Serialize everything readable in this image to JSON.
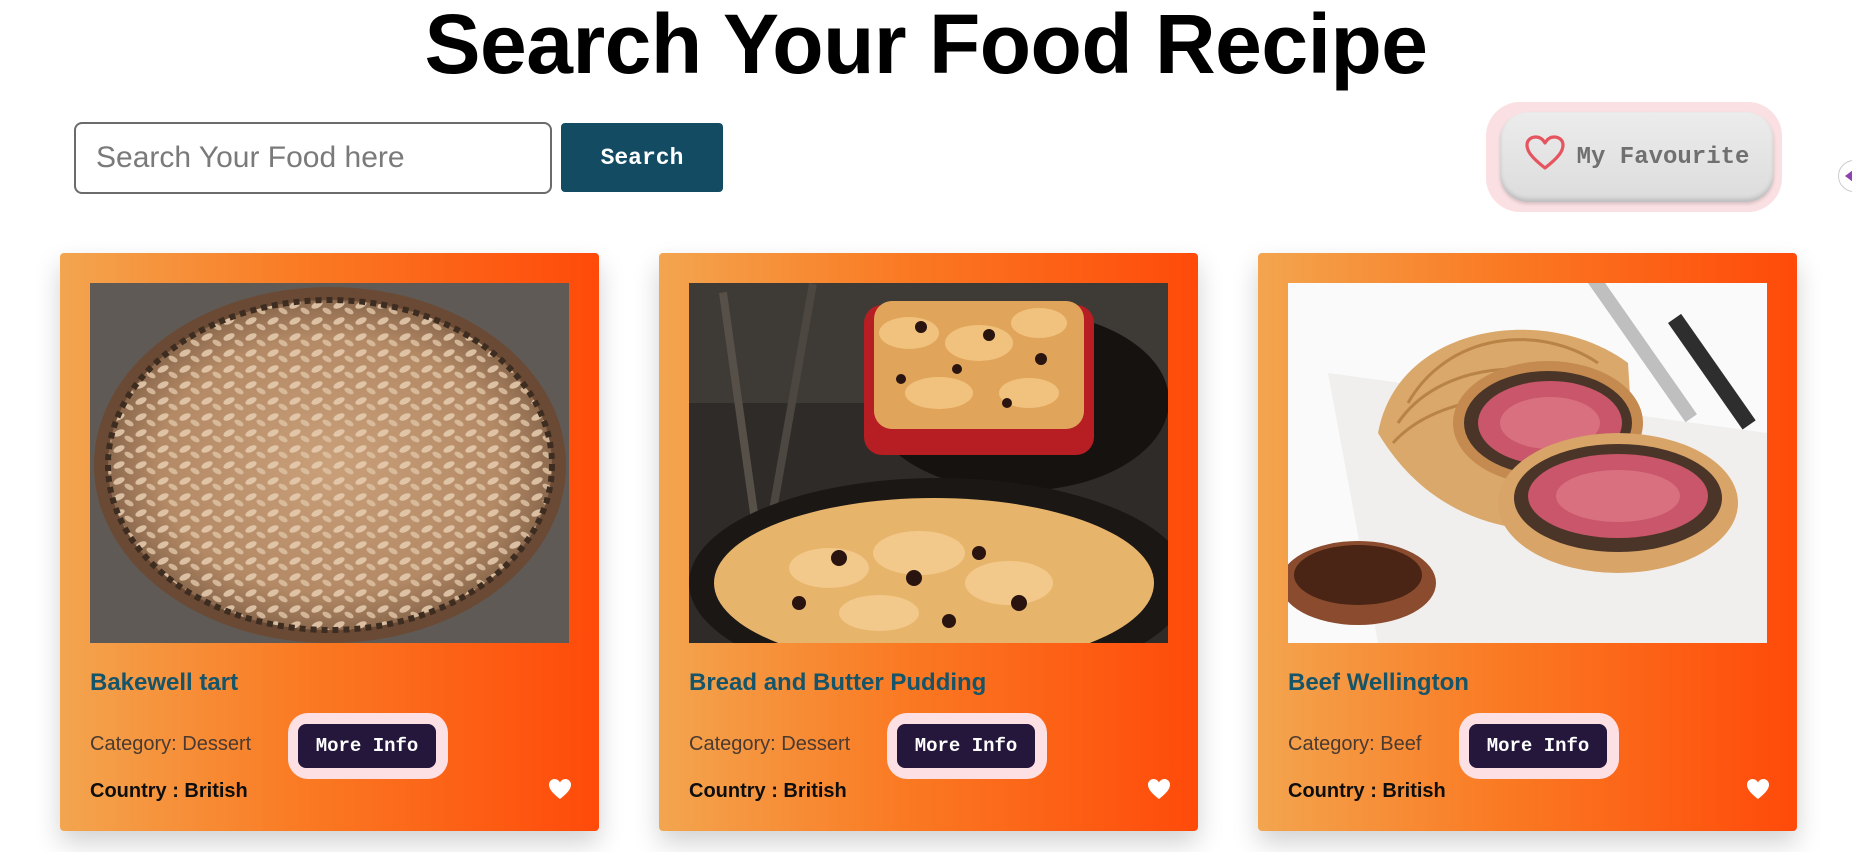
{
  "header": {
    "title": "Search Your Food Recipe"
  },
  "search": {
    "placeholder": "Search Your Food here",
    "value": "",
    "button_label": "Search"
  },
  "favourites": {
    "label": "My Favourite",
    "icon": "heart-outline-icon",
    "icon_color": "#e5555f"
  },
  "colors": {
    "card_gradient_start": "#f3a54f",
    "card_gradient_end": "#ff4a0a",
    "title_color": "#155469",
    "button_dark": "#24173b",
    "search_button": "#124b62"
  },
  "recipes": [
    {
      "title": "Bakewell tart",
      "category": "Category: Dessert",
      "country": "Country : British",
      "more_label": "More Info",
      "image_icon": "bakewell-tart-photo",
      "favourite_icon": "heart-icon"
    },
    {
      "title": "Bread and Butter Pudding",
      "category": "Category: Dessert",
      "country": "Country : British",
      "more_label": "More Info",
      "image_icon": "bread-pudding-photo",
      "favourite_icon": "heart-icon"
    },
    {
      "title": "Beef Wellington",
      "category": "Category: Beef",
      "country": "Country : British",
      "more_label": "More Info",
      "image_icon": "beef-wellington-photo",
      "favourite_icon": "heart-icon"
    }
  ]
}
